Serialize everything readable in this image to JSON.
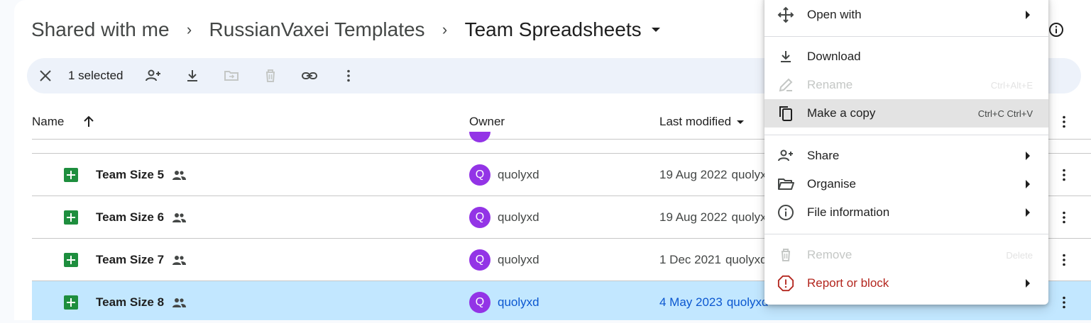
{
  "breadcrumb": {
    "items": [
      "Shared with me",
      "RussianVaxei Templates",
      "Team Spreadsheets"
    ],
    "separator": "›"
  },
  "toolbar": {
    "selected_label": "1 selected",
    "icons": [
      "close-icon",
      "add-person-icon",
      "download-icon",
      "move-to-folder-icon",
      "trash-icon",
      "link-icon",
      "more-vert-icon"
    ]
  },
  "columns": {
    "name": "Name",
    "owner": "Owner",
    "last_modified": "Last modified"
  },
  "rows": [
    {
      "name": "Team Size 5",
      "owner_initial": "Q",
      "owner": "quolyxd",
      "modified": "19 Aug 2022",
      "modified_by": "quolyx",
      "selected": false
    },
    {
      "name": "Team Size 6",
      "owner_initial": "Q",
      "owner": "quolyxd",
      "modified": "19 Aug 2022",
      "modified_by": "quolyx",
      "selected": false
    },
    {
      "name": "Team Size 7",
      "owner_initial": "Q",
      "owner": "quolyxd",
      "modified": "1 Dec 2021",
      "modified_by": "quolyxd",
      "selected": false
    },
    {
      "name": "Team Size 8",
      "owner_initial": "Q",
      "owner": "quolyxd",
      "modified": "4 May 2023",
      "modified_by": "quolyxd",
      "selected": true
    }
  ],
  "menu": {
    "open_with": "Open with",
    "download": "Download",
    "rename": "Rename",
    "rename_shortcut": "Ctrl+Alt+E",
    "make_copy": "Make a copy",
    "make_copy_shortcut": "Ctrl+C Ctrl+V",
    "share": "Share",
    "organise": "Organise",
    "file_information": "File information",
    "remove": "Remove",
    "remove_shortcut": "Delete",
    "report": "Report or block"
  },
  "colors": {
    "selected_row": "#c2e7ff",
    "sheets_green": "#1e8e3e",
    "avatar": "#9334e6",
    "danger": "#b3261e",
    "link_blue": "#0b57d0"
  }
}
